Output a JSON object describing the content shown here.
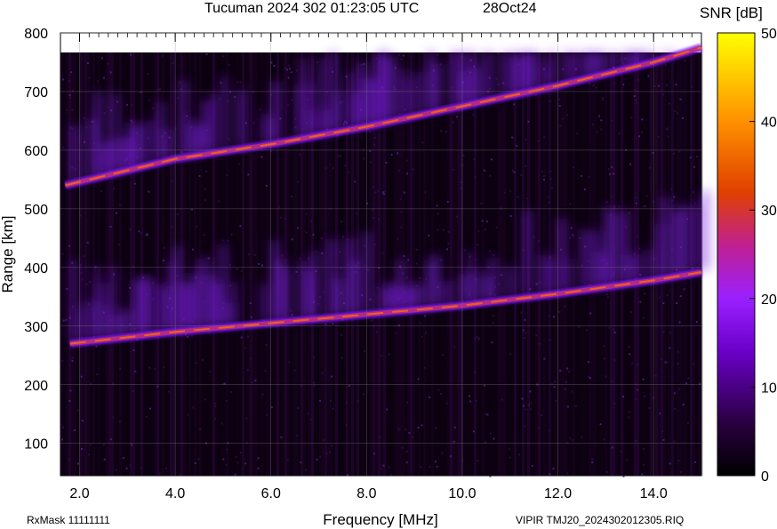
{
  "chart_data": {
    "type": "heatmap",
    "title": "Tucuman 2024 302 01:23:05 UTC",
    "date": "28Oct24",
    "xlabel": "Frequency [MHz]",
    "ylabel": "Range [km]",
    "xlim": [
      1.6,
      15.0
    ],
    "ylim": [
      45,
      800
    ],
    "xticks": [
      "2.0",
      "4.0",
      "6.0",
      "8.0",
      "10.0",
      "12.0",
      "14.0"
    ],
    "yticks": [
      "100",
      "200",
      "300",
      "400",
      "500",
      "600",
      "700",
      "800"
    ],
    "colorbar": {
      "label": "SNR [dB]",
      "range": [
        0,
        50
      ],
      "ticks": [
        "0",
        "10",
        "20",
        "30",
        "40",
        "50"
      ],
      "colors": [
        "#000000",
        "#2a0040",
        "#6a00c8",
        "#9a20ff",
        "#c02090",
        "#e04000",
        "#ff9000",
        "#ffff00"
      ]
    },
    "traces": [
      {
        "freq": [
          1.8,
          4.0,
          6.0,
          8.0,
          10.0,
          12.0,
          14.0,
          15.0
        ],
        "range": [
          270,
          290,
          305,
          320,
          335,
          355,
          378,
          392
        ]
      },
      {
        "freq": [
          1.7,
          4.0,
          6.0,
          8.0,
          10.0,
          12.0,
          14.0,
          15.0
        ],
        "range": [
          540,
          585,
          610,
          640,
          675,
          710,
          750,
          775
        ]
      }
    ]
  },
  "footer": {
    "rxmask": "RxMask 11111111",
    "file": "VIPIR  TMJ20_2024302012305.RIQ"
  }
}
